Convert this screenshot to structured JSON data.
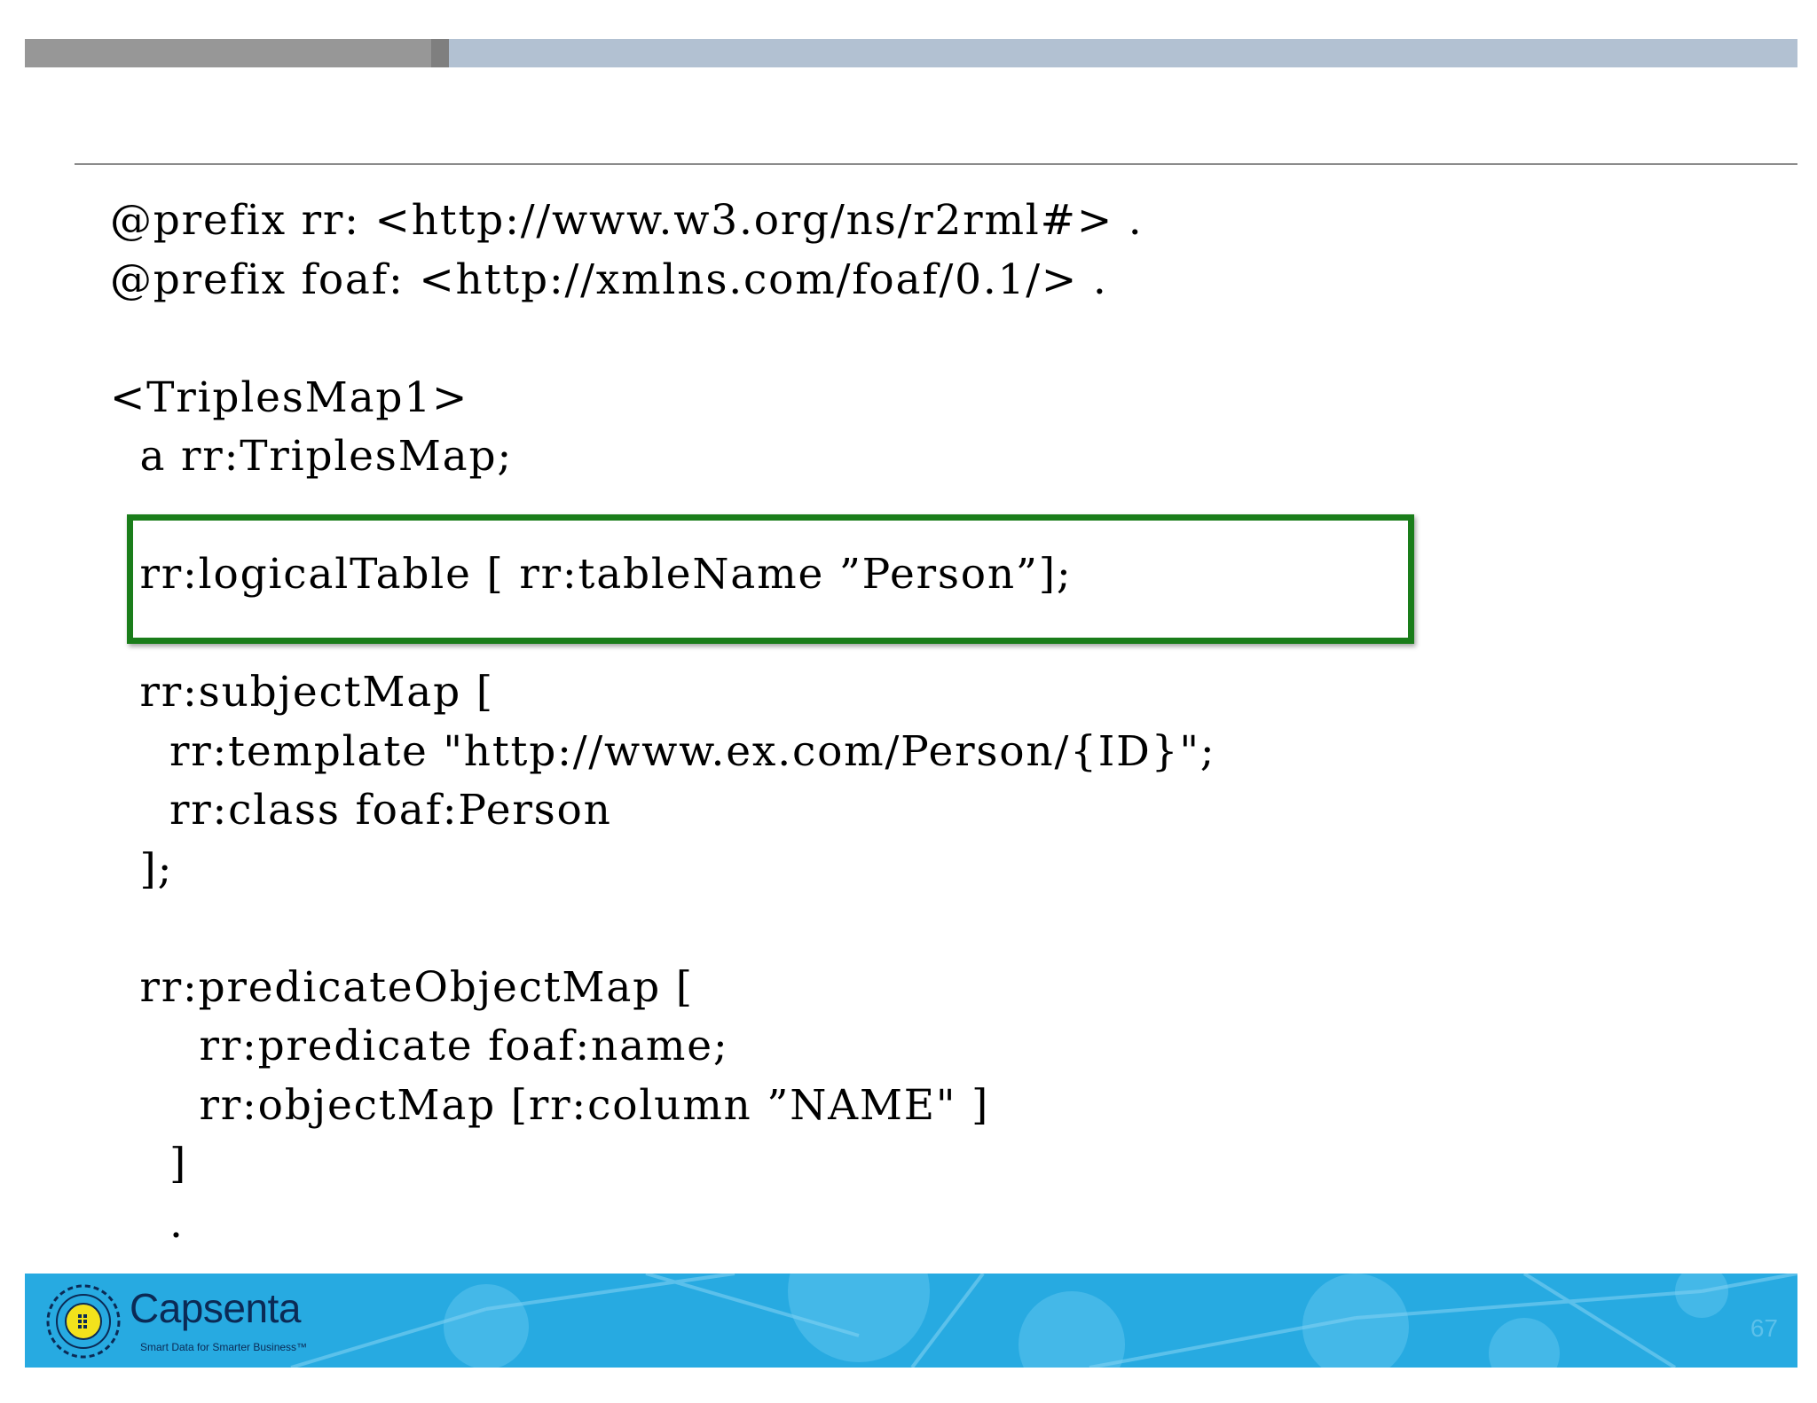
{
  "slide": {
    "code_lines": [
      "@prefix rr: <http://www.w3.org/ns/r2rml#> .",
      "@prefix foaf: <http://xmlns.com/foaf/0.1/> .",
      "",
      "<TriplesMap1>",
      "  a rr:TriplesMap;",
      "",
      "  rr:logicalTable [ rr:tableName ”Person”];",
      "",
      "  rr:subjectMap [",
      "    rr:template \"http://www.ex.com/Person/{ID}\";",
      "    rr:class foaf:Person",
      "  ];",
      "",
      "  rr:predicateObjectMap [",
      "      rr:predicate foaf:name;",
      "      rr:objectMap [rr:column ”NAME\" ]",
      "    ]",
      "    ."
    ],
    "highlight_color": "#1a7d1a"
  },
  "footer": {
    "brand_name": "Capsenta",
    "tagline": "Smart Data for Smarter Business™",
    "page_number": "67",
    "background_color": "#27aae1"
  }
}
